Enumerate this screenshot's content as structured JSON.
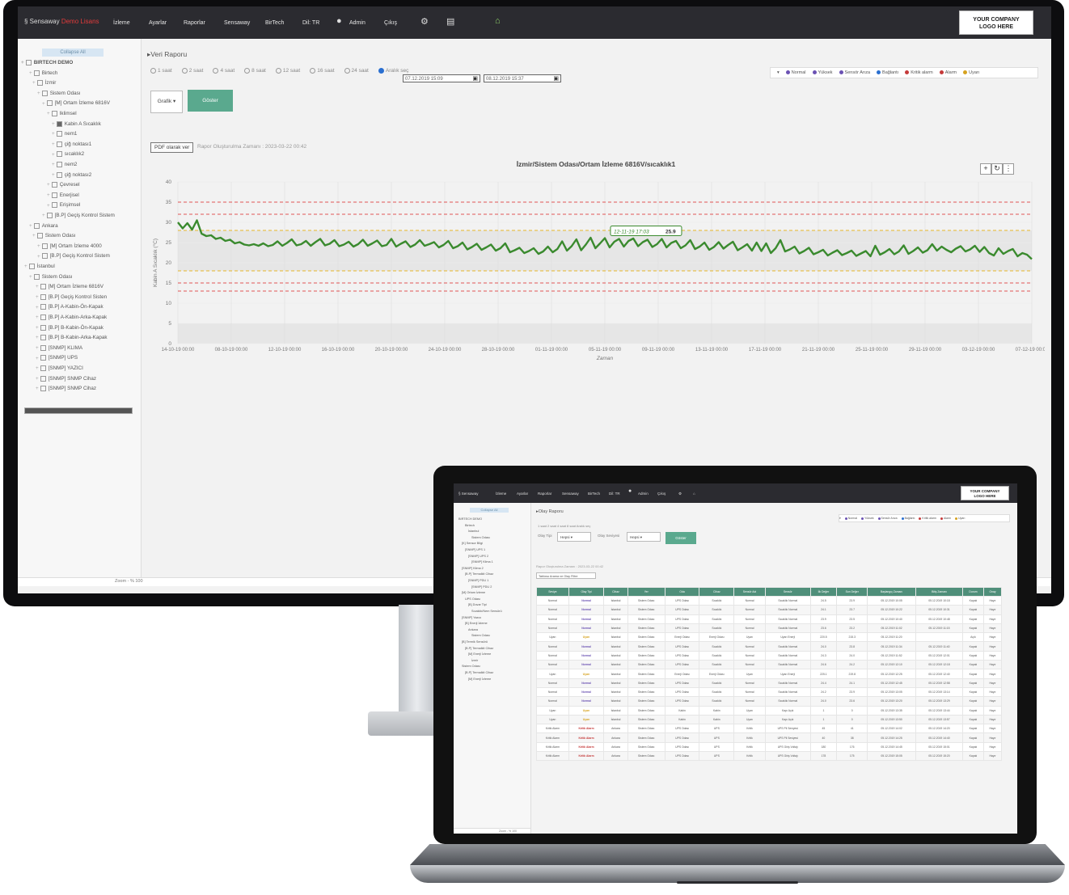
{
  "monitor": {
    "topbar": {
      "brand": "Sensaway",
      "brand_suffix": "Demo Lisans",
      "nav": [
        "İzleme",
        "Ayarlar",
        "Raporlar",
        "Sensaway",
        "BirTech",
        "Dil: TR"
      ],
      "user": "Admin",
      "logout": "Çıkış",
      "logo_text_1": "YOUR COMPANY",
      "logo_text_2": "LOGO HERE"
    },
    "sidebar": {
      "header": "Collapse All",
      "tree": [
        "BIRTECH DEMO",
        "Birtech",
        "İzmir",
        "Sistem Odası",
        "[M] Ortam İzleme 6816V",
        "Iklimsel",
        "Kabin A Sıcaklık",
        "nem1",
        "çiğ noktası1",
        "sıcaklık2",
        "nem2",
        "çiğ noktası2",
        "Çevresel",
        "Enerjisel",
        "Erişimsel",
        "[B.P] Geçiş Kontrol Sistem",
        "Ankara",
        "Sistem Odası",
        "[M] Ortam İzleme 4000",
        "[B.P] Geçiş Kontrol Sistem",
        "İstanbul",
        "Sistem Odası",
        "[M] Ortam İzleme 6816V",
        "[B.P] Geçiş Kontrol Sisten",
        "[B.P] A-Kabin-Ön-Kapak",
        "[B.P] A-Kabin-Arka-Kapak",
        "[B.P] B-Kabin-Ön-Kapak",
        "[B.P] B-Kabin-Arka-Kapak",
        "[SNMP] KLIMA",
        "[SNMP] UPS",
        "[SNMP] YAZICI",
        "[SNMP] SNMP Cihaz",
        "[SNMP] SNMP Cihaz"
      ],
      "footer_zoom": "Zoom - % 100"
    },
    "main": {
      "breadcrumb": "Veri Raporu",
      "radios": [
        "1 saat",
        "2 saat",
        "4 saat",
        "8 saat",
        "12 saat",
        "16 saat",
        "24 saat",
        "Aralık seç"
      ],
      "date_from": "07.12.2019 15:09",
      "date_to": "08.12.2019 15:37",
      "legend": [
        {
          "label": "Normal",
          "color": "#6b52b3"
        },
        {
          "label": "Yüksek",
          "color": "#6b52b3"
        },
        {
          "label": "Sensör Arıza",
          "color": "#6b52b3"
        },
        {
          "label": "Bağlantı",
          "color": "#2a6fd0"
        },
        {
          "label": "Kritik alarm",
          "color": "#c53a3a"
        },
        {
          "label": "Alarm",
          "color": "#c53a3a"
        },
        {
          "label": "Uyarı",
          "color": "#d6a21f"
        }
      ],
      "type_select": "Grafik",
      "show_button": "Göster",
      "pdf_button": "PDF olarak ver",
      "report_time": "Rapor Oluşturulma Zamanı : 2023-03-22 00:42",
      "chart_title": "İzmir/Sistem Odası/Ortam İzleme 6816V/sıcaklık1"
    }
  },
  "chart_data": {
    "type": "line",
    "title": "İzmir/Sistem Odası/Ortam İzleme 6816V/sıcaklık1",
    "xlabel": "Zaman",
    "ylabel": "Kabin A Sıcaklık (°C)",
    "ylim": [
      0,
      40
    ],
    "yticks": [
      0,
      5,
      10,
      15,
      20,
      25,
      30,
      35,
      40
    ],
    "xticks": [
      "14-10-19 00:00",
      "08-10-19 00:00",
      "12-10-19 00:00",
      "16-10-19 00:00",
      "20-10-19 00:00",
      "24-10-19 00:00",
      "28-10-19 00:00",
      "01-11-19 00:00",
      "05-11-19 00:00",
      "09-11-19 00:00",
      "13-11-19 00:00",
      "17-11-19 00:00",
      "21-11-19 00:00",
      "25-11-19 00:00",
      "29-11-19 00:00",
      "03-12-19 00:00",
      "07-12-19 00:00"
    ],
    "thresholds": [
      {
        "value": 35,
        "color": "#e05555"
      },
      {
        "value": 32,
        "color": "#e05555"
      },
      {
        "value": 28,
        "color": "#e6b62a"
      },
      {
        "value": 18,
        "color": "#e6b62a"
      },
      {
        "value": 15,
        "color": "#e05555"
      },
      {
        "value": 13,
        "color": "#e05555"
      }
    ],
    "tooltip": {
      "time": "12-11-19 17:03",
      "value": 25.9
    },
    "series": [
      {
        "color": "#3a8a2e",
        "values": [
          30,
          28.5,
          29.8,
          28.2,
          30.5,
          27.2,
          26.6,
          26.8,
          25.9,
          26.2,
          25.4,
          25.7,
          24.8,
          25.1,
          24.5,
          24.3,
          24.6,
          24.2,
          24.8,
          24.1,
          24.4,
          25.3,
          24.2,
          24.9,
          25.8,
          24.3,
          24.6,
          25.4,
          24.2,
          25.1,
          25.9,
          24.3,
          24.7,
          25.6,
          24.1,
          24.5,
          25.2,
          24.0,
          24.6,
          25.7,
          24.2,
          24.8,
          25.5,
          24.1,
          24.4,
          25.9,
          24.0,
          24.7,
          25.3,
          23.9,
          24.5,
          25.6,
          24.2,
          24.6,
          25.1,
          23.8,
          24.4,
          25.4,
          23.6,
          24.1,
          25.0,
          23.3,
          23.9,
          24.7,
          23.2,
          23.8,
          24.5,
          23.0,
          23.6,
          24.8,
          22.6,
          23.1,
          23.7,
          22.4,
          22.9,
          23.6,
          22.2,
          22.8,
          24.0,
          22.6,
          23.4,
          25.3,
          23.0,
          24.1,
          25.8,
          23.1,
          24.5,
          26.2,
          23.6,
          24.8,
          26.1,
          23.8,
          25.2,
          25.9,
          24.0,
          25.4,
          26.0,
          24.1,
          25.1,
          25.7,
          23.9,
          24.6,
          25.9,
          23.8,
          24.9,
          25.4,
          23.6,
          24.3,
          25.6,
          23.4,
          24.0,
          25.0,
          23.2,
          23.9,
          25.1,
          23.5,
          24.4,
          25.2,
          23.1,
          23.8,
          24.6,
          23.0,
          25.0,
          22.9,
          24.8,
          22.4,
          23.6,
          25.6,
          22.8,
          23.3,
          24.0,
          22.3,
          22.9,
          23.7,
          22.1,
          22.6,
          23.2,
          21.8,
          22.5,
          23.1,
          21.9,
          22.4,
          23.0,
          21.7,
          22.3,
          22.9,
          21.6,
          24.2,
          22.0,
          22.6,
          23.4,
          22.1,
          22.8,
          24.3,
          22.2,
          22.9,
          23.8,
          22.5,
          23.1,
          24.6,
          23.0,
          24.0,
          23.2,
          22.6,
          23.5,
          24.1,
          22.8,
          23.3,
          24.2,
          22.7,
          23.9,
          22.4,
          21.8,
          23.6,
          22.2,
          22.9,
          23.4,
          21.6,
          22.4,
          22.0,
          20.9
        ]
      }
    ]
  },
  "laptop": {
    "topbar": {
      "brand": "Sensaway",
      "nav": [
        "İzleme",
        "Ayarlar",
        "Raporlar",
        "Sensaway",
        "BirTech",
        "Dil: TR"
      ],
      "user": "Admin",
      "logout": "Çıkış",
      "logo_text_1": "YOUR COMPANY",
      "logo_text_2": "LOGO HERE"
    },
    "sidebar": {
      "header": "Collapse All",
      "tree": [
        "BIRTECH DEMO",
        "Birtech",
        "İstanbul",
        "Sistem Odası",
        "[K] Sensor Bilgi",
        "[SNMP] UPS 1",
        "[SNMP] UPS 2",
        "[SNMP] Klima 1",
        "[SNMP] Klima 2",
        "[B.P] Termalkit Cihaz",
        "[SNMP] PDU 1",
        "[SNMP] PDU 2",
        "[M] Ortam İzleme",
        "UPS Odası",
        "[B] Duvar Tipi",
        "Sıcaklık/Nem Sensörü",
        "[SNMP] Yazıcı",
        "[B] Enerji İzleme",
        "Ankara",
        "Sistem Odası",
        "[B] Termik Sensörü",
        "[B.P] Termalkit Cihaz",
        "[M] Enerji İzleme",
        "İzmir",
        "Sistem Odası",
        "[B.P] Termalkit Cihaz",
        "[M] Enerji İzleme"
      ],
      "footer_zoom": "Zoom - % 100"
    },
    "main": {
      "breadcrumb": "Olay Raporu",
      "radios": "1 saat  2 saat  4 saat  8 saat  Aralık seç",
      "type_label": "Olay Tipi",
      "type_value": "Hepsi",
      "severity_label": "Olay Seviyesi",
      "severity_value": "Hepsi",
      "show_button": "Göster",
      "legend": [
        {
          "label": "Normal",
          "color": "#6b52b3"
        },
        {
          "label": "Yüksek",
          "color": "#6b52b3"
        },
        {
          "label": "Sensör Arıza",
          "color": "#6b52b3"
        },
        {
          "label": "Bağlantı",
          "color": "#2a6fd0"
        },
        {
          "label": "Kritik alarm",
          "color": "#c53a3a"
        },
        {
          "label": "Alarm",
          "color": "#c53a3a"
        },
        {
          "label": "Uyarı",
          "color": "#d6a21f"
        }
      ],
      "report_time": "Rapor Oluşturulma Zamanı : 2023-03-22 00:42",
      "filter": "Tablosu Arama ve Olay Filtre",
      "columns": [
        "Seviye",
        "Olay Tipi",
        "Cihaz",
        "Yer",
        "Oda",
        "Cihaz",
        "Sensör Adı",
        "Sensör",
        "İlk Değer",
        "Son Değer",
        "Başlangıç Zamanı",
        "Bitiş Zamanı",
        "Durum",
        "Onay"
      ],
      "rows": [
        [
          "Normal",
          "Normal",
          "İstanbul",
          "Sistem Odası",
          "UPS Odası",
          "Sıcaklık",
          "Normal",
          "Sıcaklık Normal",
          "24.5",
          "23.9",
          "05.12.2019 10:05",
          "05.12.2019 10:18",
          "Kapalı",
          "Hayır"
        ],
        [
          "Normal",
          "Normal",
          "İstanbul",
          "Sistem Odası",
          "UPS Odası",
          "Sıcaklık",
          "Normal",
          "Sıcaklık Normal",
          "24.1",
          "23.7",
          "05.12.2019 10:22",
          "05.12.2019 10:31",
          "Kapalı",
          "Hayır"
        ],
        [
          "Normal",
          "Normal",
          "İstanbul",
          "Sistem Odası",
          "UPS Odası",
          "Sıcaklık",
          "Normal",
          "Sıcaklık Normal",
          "23.9",
          "23.5",
          "05.12.2019 10:40",
          "05.12.2019 10:48",
          "Kapalı",
          "Hayır"
        ],
        [
          "Normal",
          "Normal",
          "İstanbul",
          "Sistem Odası",
          "UPS Odası",
          "Sıcaklık",
          "Normal",
          "Sıcaklık Normal",
          "23.6",
          "23.2",
          "05.12.2019 11:02",
          "05.12.2019 11:15",
          "Kapalı",
          "Hayır"
        ],
        [
          "Uyarı",
          "Uyarı",
          "İstanbul",
          "Sistem Odası",
          "Enerji Odası",
          "Enerji Odası",
          "Uyarı",
          "Uyarı Enerji",
          "220.5",
          "215.3",
          "05.12.2019 11:20",
          "",
          "Açık",
          "Hayır"
        ],
        [
          "Normal",
          "Normal",
          "İstanbul",
          "Sistem Odası",
          "UPS Odası",
          "Sıcaklık",
          "Normal",
          "Sıcaklık Normal",
          "24.0",
          "23.8",
          "05.12.2019 11:34",
          "05.12.2019 11:40",
          "Kapalı",
          "Hayır"
        ],
        [
          "Normal",
          "Normal",
          "İstanbul",
          "Sistem Odası",
          "UPS Odası",
          "Sıcaklık",
          "Normal",
          "Sıcaklık Normal",
          "24.3",
          "24.0",
          "05.12.2019 11:52",
          "05.12.2019 12:01",
          "Kapalı",
          "Hayır"
        ],
        [
          "Normal",
          "Normal",
          "İstanbul",
          "Sistem Odası",
          "UPS Odası",
          "Sıcaklık",
          "Normal",
          "Sıcaklık Normal",
          "24.6",
          "24.2",
          "05.12.2019 12:10",
          "05.12.2019 12:18",
          "Kapalı",
          "Hayır"
        ],
        [
          "Uyarı",
          "Uyarı",
          "İstanbul",
          "Sistem Odası",
          "Enerji Odası",
          "Enerji Odası",
          "Uyarı",
          "Uyarı Enerji",
          "225.1",
          "219.8",
          "05.12.2019 12:25",
          "05.12.2019 12:40",
          "Kapalı",
          "Hayır"
        ],
        [
          "Normal",
          "Normal",
          "İstanbul",
          "Sistem Odası",
          "UPS Odası",
          "Sıcaklık",
          "Normal",
          "Sıcaklık Normal",
          "24.4",
          "24.1",
          "05.12.2019 12:45",
          "05.12.2019 12:58",
          "Kapalı",
          "Hayır"
        ],
        [
          "Normal",
          "Normal",
          "İstanbul",
          "Sistem Odası",
          "UPS Odası",
          "Sıcaklık",
          "Normal",
          "Sıcaklık Normal",
          "24.2",
          "23.9",
          "05.12.2019 13:05",
          "05.12.2019 13:14",
          "Kapalı",
          "Hayır"
        ],
        [
          "Normal",
          "Normal",
          "İstanbul",
          "Sistem Odası",
          "UPS Odası",
          "Sıcaklık",
          "Normal",
          "Sıcaklık Normal",
          "24.0",
          "23.6",
          "05.12.2019 13:20",
          "05.12.2019 13:29",
          "Kapalı",
          "Hayır"
        ],
        [
          "Uyarı",
          "Uyarı",
          "İstanbul",
          "Sistem Odası",
          "Kabin",
          "Kabin",
          "Uyarı",
          "Kapı Açık",
          "1",
          "0",
          "05.12.2019 13:35",
          "05.12.2019 13:44",
          "Kapalı",
          "Hayır"
        ],
        [
          "Uyarı",
          "Uyarı",
          "İstanbul",
          "Sistem Odası",
          "Kabin",
          "Kabin",
          "Uyarı",
          "Kapı Açık",
          "1",
          "0",
          "05.12.2019 13:50",
          "05.12.2019 13:57",
          "Kapalı",
          "Hayır"
        ],
        [
          "Kritik Alarm",
          "Kritik Alarm",
          "Ankara",
          "Sistem Odası",
          "UPS Odası",
          "UPS",
          "Kritik",
          "UPS Pil Seviyesi",
          "45",
          "41",
          "05.12.2019 14:02",
          "05.12.2019 14:20",
          "Kapalı",
          "Hayır"
        ],
        [
          "Kritik Alarm",
          "Kritik Alarm",
          "Ankara",
          "Sistem Odası",
          "UPS Odası",
          "UPS",
          "Kritik",
          "UPS Pil Seviyesi",
          "40",
          "38",
          "05.12.2019 14:25",
          "05.12.2019 14:40",
          "Kapalı",
          "Hayır"
        ],
        [
          "Kritik Alarm",
          "Kritik Alarm",
          "Ankara",
          "Sistem Odası",
          "UPS Odası",
          "UPS",
          "Kritik",
          "UPS Giriş Voltajı",
          "180",
          "176",
          "05.12.2019 14:45",
          "05.12.2019 15:01",
          "Kapalı",
          "Hayır"
        ],
        [
          "Kritik Alarm",
          "Kritik Alarm",
          "Ankara",
          "Sistem Odası",
          "UPS Odası",
          "UPS",
          "Kritik",
          "UPS Giriş Voltajı",
          "178",
          "175",
          "05.12.2019 15:05",
          "05.12.2019 15:20",
          "Kapalı",
          "Hayır"
        ]
      ]
    }
  }
}
